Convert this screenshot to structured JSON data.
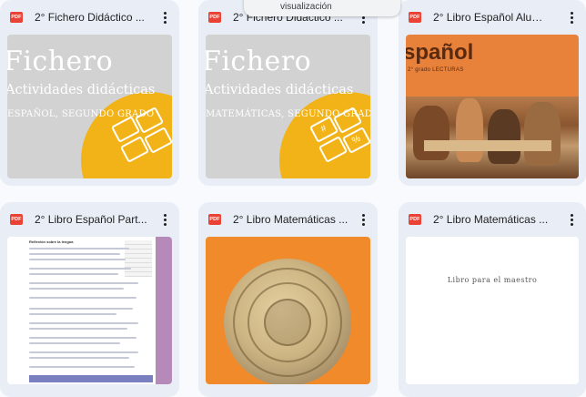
{
  "tooltip": {
    "text": "visualización"
  },
  "files": [
    {
      "badge": "PDF",
      "title": "2° Fichero Didáctico ...",
      "thumb": {
        "heading": "Fichero",
        "sub": "Actividades didácticas",
        "sub2": "ESPAÑOL, SEGUNDO GRADO"
      }
    },
    {
      "badge": "PDF",
      "title": "2° Fichero Didáctico ...",
      "thumb": {
        "heading": "Fichero",
        "sub": "Actividades didácticas",
        "sub2": "MATEMÁTICAS, SEGUNDO GRADO"
      }
    },
    {
      "badge": "PDF",
      "title": "2° Libro Español Alum...",
      "thumb": {
        "heading": "spañol",
        "sub": "2° grado LECTURAS"
      }
    },
    {
      "badge": "PDF",
      "title": "2° Libro Español Part...",
      "thumb": {
        "heading": "Reflexión sobre la lengua"
      }
    },
    {
      "badge": "PDF",
      "title": "2° Libro Matemáticas ...",
      "thumb": {}
    },
    {
      "badge": "PDF",
      "title": "2° Libro Matemáticas ...",
      "thumb": {
        "heading": "Libro para el maestro"
      }
    }
  ],
  "icons": {
    "file_type": "pdf-icon",
    "menu": "more-vert-icon"
  },
  "colors": {
    "card_bg": "#e9eef6",
    "pdf_red": "#ea4335",
    "page_bg": "#f8fafd"
  }
}
